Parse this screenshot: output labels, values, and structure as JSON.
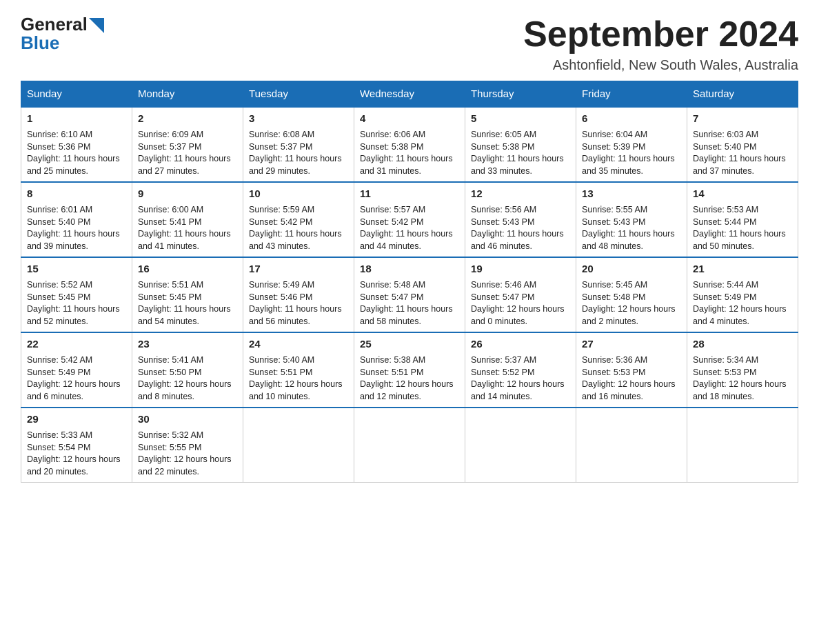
{
  "header": {
    "logo_general": "General",
    "logo_blue": "Blue",
    "month_title": "September 2024",
    "location": "Ashtonfield, New South Wales, Australia"
  },
  "days_of_week": [
    "Sunday",
    "Monday",
    "Tuesday",
    "Wednesday",
    "Thursday",
    "Friday",
    "Saturday"
  ],
  "weeks": [
    [
      {
        "day": "1",
        "sunrise": "6:10 AM",
        "sunset": "5:36 PM",
        "daylight": "11 hours and 25 minutes."
      },
      {
        "day": "2",
        "sunrise": "6:09 AM",
        "sunset": "5:37 PM",
        "daylight": "11 hours and 27 minutes."
      },
      {
        "day": "3",
        "sunrise": "6:08 AM",
        "sunset": "5:37 PM",
        "daylight": "11 hours and 29 minutes."
      },
      {
        "day": "4",
        "sunrise": "6:06 AM",
        "sunset": "5:38 PM",
        "daylight": "11 hours and 31 minutes."
      },
      {
        "day": "5",
        "sunrise": "6:05 AM",
        "sunset": "5:38 PM",
        "daylight": "11 hours and 33 minutes."
      },
      {
        "day": "6",
        "sunrise": "6:04 AM",
        "sunset": "5:39 PM",
        "daylight": "11 hours and 35 minutes."
      },
      {
        "day": "7",
        "sunrise": "6:03 AM",
        "sunset": "5:40 PM",
        "daylight": "11 hours and 37 minutes."
      }
    ],
    [
      {
        "day": "8",
        "sunrise": "6:01 AM",
        "sunset": "5:40 PM",
        "daylight": "11 hours and 39 minutes."
      },
      {
        "day": "9",
        "sunrise": "6:00 AM",
        "sunset": "5:41 PM",
        "daylight": "11 hours and 41 minutes."
      },
      {
        "day": "10",
        "sunrise": "5:59 AM",
        "sunset": "5:42 PM",
        "daylight": "11 hours and 43 minutes."
      },
      {
        "day": "11",
        "sunrise": "5:57 AM",
        "sunset": "5:42 PM",
        "daylight": "11 hours and 44 minutes."
      },
      {
        "day": "12",
        "sunrise": "5:56 AM",
        "sunset": "5:43 PM",
        "daylight": "11 hours and 46 minutes."
      },
      {
        "day": "13",
        "sunrise": "5:55 AM",
        "sunset": "5:43 PM",
        "daylight": "11 hours and 48 minutes."
      },
      {
        "day": "14",
        "sunrise": "5:53 AM",
        "sunset": "5:44 PM",
        "daylight": "11 hours and 50 minutes."
      }
    ],
    [
      {
        "day": "15",
        "sunrise": "5:52 AM",
        "sunset": "5:45 PM",
        "daylight": "11 hours and 52 minutes."
      },
      {
        "day": "16",
        "sunrise": "5:51 AM",
        "sunset": "5:45 PM",
        "daylight": "11 hours and 54 minutes."
      },
      {
        "day": "17",
        "sunrise": "5:49 AM",
        "sunset": "5:46 PM",
        "daylight": "11 hours and 56 minutes."
      },
      {
        "day": "18",
        "sunrise": "5:48 AM",
        "sunset": "5:47 PM",
        "daylight": "11 hours and 58 minutes."
      },
      {
        "day": "19",
        "sunrise": "5:46 AM",
        "sunset": "5:47 PM",
        "daylight": "12 hours and 0 minutes."
      },
      {
        "day": "20",
        "sunrise": "5:45 AM",
        "sunset": "5:48 PM",
        "daylight": "12 hours and 2 minutes."
      },
      {
        "day": "21",
        "sunrise": "5:44 AM",
        "sunset": "5:49 PM",
        "daylight": "12 hours and 4 minutes."
      }
    ],
    [
      {
        "day": "22",
        "sunrise": "5:42 AM",
        "sunset": "5:49 PM",
        "daylight": "12 hours and 6 minutes."
      },
      {
        "day": "23",
        "sunrise": "5:41 AM",
        "sunset": "5:50 PM",
        "daylight": "12 hours and 8 minutes."
      },
      {
        "day": "24",
        "sunrise": "5:40 AM",
        "sunset": "5:51 PM",
        "daylight": "12 hours and 10 minutes."
      },
      {
        "day": "25",
        "sunrise": "5:38 AM",
        "sunset": "5:51 PM",
        "daylight": "12 hours and 12 minutes."
      },
      {
        "day": "26",
        "sunrise": "5:37 AM",
        "sunset": "5:52 PM",
        "daylight": "12 hours and 14 minutes."
      },
      {
        "day": "27",
        "sunrise": "5:36 AM",
        "sunset": "5:53 PM",
        "daylight": "12 hours and 16 minutes."
      },
      {
        "day": "28",
        "sunrise": "5:34 AM",
        "sunset": "5:53 PM",
        "daylight": "12 hours and 18 minutes."
      }
    ],
    [
      {
        "day": "29",
        "sunrise": "5:33 AM",
        "sunset": "5:54 PM",
        "daylight": "12 hours and 20 minutes."
      },
      {
        "day": "30",
        "sunrise": "5:32 AM",
        "sunset": "5:55 PM",
        "daylight": "12 hours and 22 minutes."
      },
      null,
      null,
      null,
      null,
      null
    ]
  ],
  "labels": {
    "sunrise_prefix": "Sunrise: ",
    "sunset_prefix": "Sunset: ",
    "daylight_prefix": "Daylight: "
  }
}
